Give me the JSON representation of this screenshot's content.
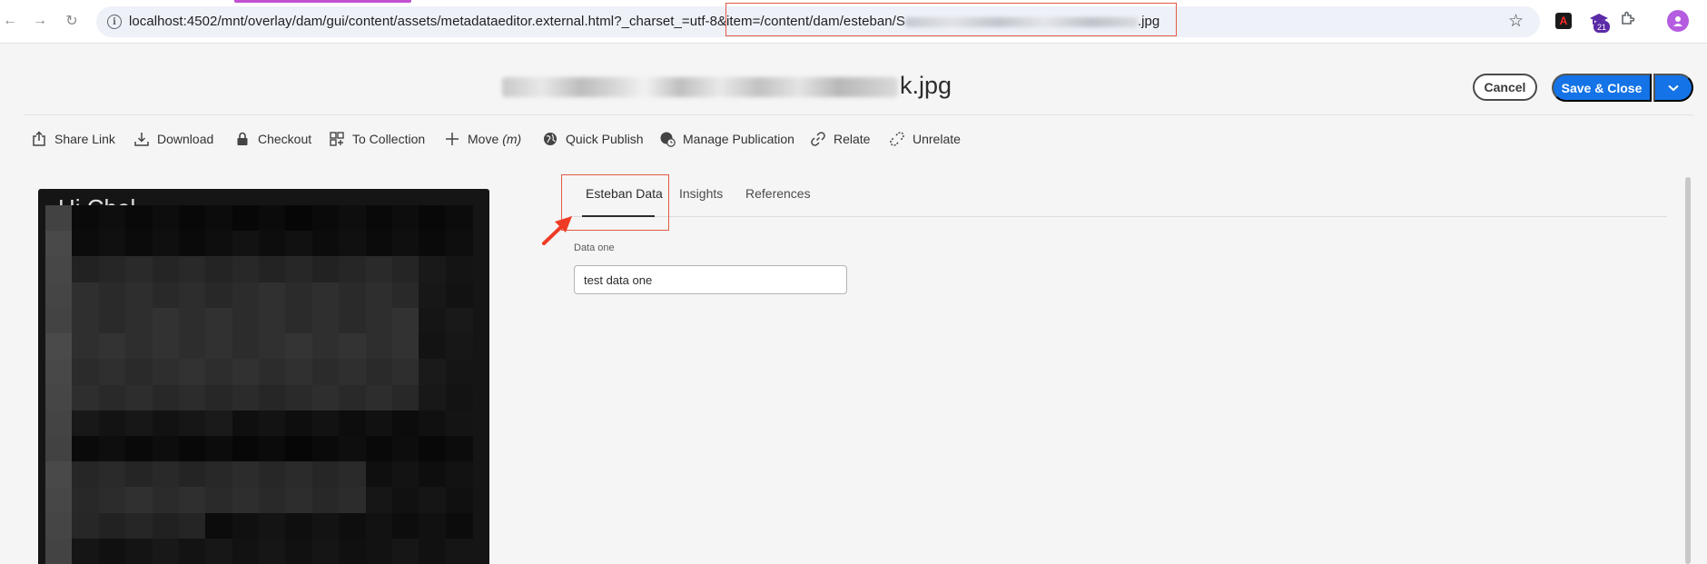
{
  "browser": {
    "url_prefix": "localhost:4502/mnt/overlay/dam/gui/content/assets/metadataeditor.external.html?_charset_=utf-8&item=/content/dam/esteban/S",
    "url_suffix": ".jpg",
    "extension_badge": "21"
  },
  "header": {
    "title_suffix": "k.jpg",
    "cancel_label": "Cancel",
    "save_label": "Save & Close"
  },
  "actions": [
    {
      "label": "Share Link",
      "icon": "share-icon"
    },
    {
      "label": "Download",
      "icon": "download-icon"
    },
    {
      "label": "Checkout",
      "icon": "lock-icon"
    },
    {
      "label": "To Collection",
      "icon": "collection-icon"
    },
    {
      "label": "Move",
      "shortcut": "(m)",
      "icon": "move-icon"
    },
    {
      "label": "Quick Publish",
      "icon": "globe-icon"
    },
    {
      "label": "Manage Publication",
      "icon": "globe-clock-icon"
    },
    {
      "label": "Relate",
      "icon": "link-icon"
    },
    {
      "label": "Unrelate",
      "icon": "unlink-icon"
    }
  ],
  "preview": {
    "overlay_text": "Hi Chel"
  },
  "tabs": [
    {
      "label": "Esteban Data",
      "active": true
    },
    {
      "label": "Insights",
      "active": false
    },
    {
      "label": "References",
      "active": false
    }
  ],
  "form": {
    "field_label": "Data one",
    "field_value": "test data one"
  },
  "colors": {
    "accent": "#1473e6",
    "annotation": "#e25a45"
  }
}
